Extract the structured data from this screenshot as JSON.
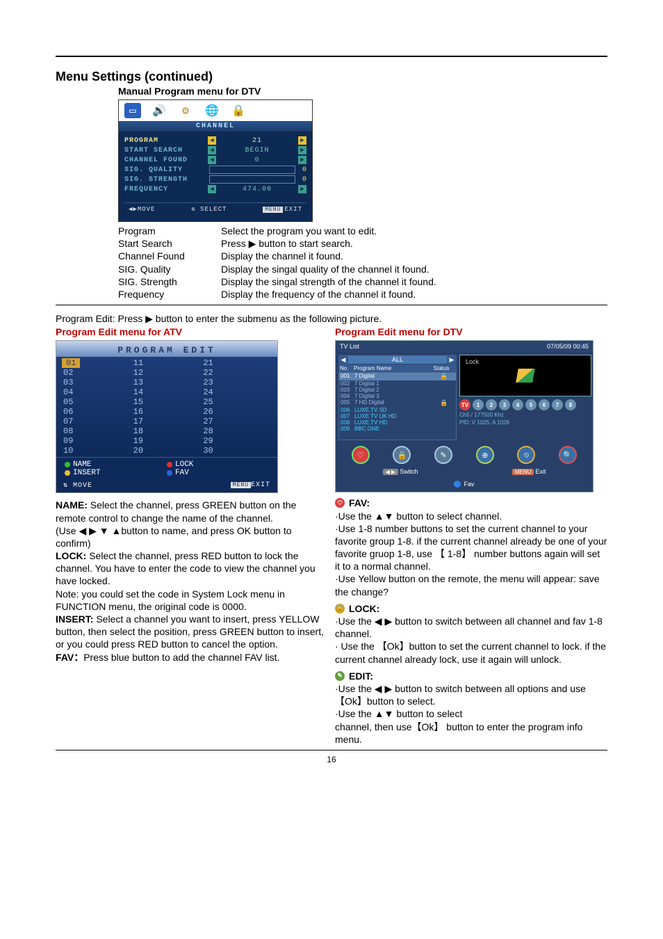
{
  "page_number": "16",
  "heading": "Menu Settings (continued)",
  "subheading_manual": "Manual Program menu for DTV",
  "dtv_menu": {
    "header": "CHANNEL",
    "rows": {
      "program": {
        "label": "PROGRAM",
        "value": "21"
      },
      "start_search": {
        "label": "START SEARCH",
        "value": "BEGIN"
      },
      "channel_found": {
        "label": "CHANNEL FOUND",
        "value": "0"
      },
      "sig_quality": {
        "label": "SIG. QUALITY",
        "value": "0"
      },
      "sig_strength": {
        "label": "SIG. STRENGTH",
        "value": "0"
      },
      "frequency": {
        "label": "FREQUENCY",
        "value": "474.00"
      }
    },
    "footer": {
      "move": "MOVE",
      "select": "SELECT",
      "exit_tag": "MENU",
      "exit": "EXIT"
    }
  },
  "param_labels": {
    "program": "Program",
    "start_search": "Start Search",
    "channel_found": "Channel Found",
    "sig_quality": "SIG. Quality",
    "sig_strength": "SIG. Strength",
    "frequency": "Frequency"
  },
  "param_desc": {
    "program": "Select the program you want to edit.",
    "start_search": "Press ▶ button to start search.",
    "channel_found": "Display the channel it found.",
    "sig_quality": "Display the singal quality of the channel it found.",
    "sig_strength": "Display the singal strength of the channel it found.",
    "frequency": "Display the frequency of the channel it found."
  },
  "program_edit_intro": "Program Edit: Press ▶ button to enter the submenu as the following picture.",
  "atv_header": "Program Edit menu for ATV",
  "dtv_header": "Program Edit menu for DTV",
  "atv_shot": {
    "title": "PROGRAM EDIT",
    "cols": [
      [
        "01",
        "02",
        "03",
        "04",
        "05",
        "06",
        "07",
        "08",
        "09",
        "10"
      ],
      [
        "11",
        "12",
        "13",
        "14",
        "15",
        "16",
        "17",
        "18",
        "19",
        "20"
      ],
      [
        "21",
        "22",
        "23",
        "24",
        "25",
        "26",
        "27",
        "28",
        "29",
        "30"
      ]
    ],
    "legend": {
      "name": "NAME",
      "lock": "LOCK",
      "insert": "INSERT",
      "fav": "FAV"
    },
    "foot": {
      "move": "MOVE",
      "exit_tag": "MENU",
      "exit": "EXIT"
    }
  },
  "dtv_list": {
    "title": "TV List",
    "timestamp": "07/05/09 00:45",
    "tab_label": "ALL",
    "columns": {
      "no": "No.",
      "name": "Program Name",
      "status": "Status"
    },
    "rows": [
      {
        "no": "001",
        "name": "7 Digital",
        "lock": true,
        "hl": true
      },
      {
        "no": "002",
        "name": "7 Digital 1"
      },
      {
        "no": "003",
        "name": "7 Digital 2"
      },
      {
        "no": "004",
        "name": "7 Digital 3"
      },
      {
        "no": "005",
        "name": "7 HD Digital",
        "lock": true
      },
      {
        "no": "006",
        "name": "LUXE.TV SD",
        "blue": true
      },
      {
        "no": "007",
        "name": "LUXE.TV UK HD",
        "blue": true
      },
      {
        "no": "008",
        "name": "LUXE.TV HD",
        "blue": true
      },
      {
        "no": "009",
        "name": "BBC ONE",
        "blue": true
      }
    ],
    "preview_label": "Lock",
    "info1": "Ch5 / 177500 Khz",
    "info2": "PID: V 1025, A 1026",
    "foot": {
      "switch": "Switch",
      "exit": "Exit",
      "exit_tag": "MENU",
      "fav": "Fav",
      "switch_tag": "◀ ▶"
    }
  },
  "left_text": {
    "name_lbl": "NAME:",
    "name_body": " Select the channel, press GREEN button on the remote control to change the name of the channel.",
    "name_note": "(Use ◀ ▶ ▼ ▲button to name, and press OK button to confirm)",
    "lock_lbl": "LOCK:",
    "lock_body": " Select the channel, press RED button to lock the channel. You have to enter the code to view the channel you have locked.",
    "lock_note": "Note: you could set the code in System Lock menu in FUNCTION menu, the original code is 0000.",
    "insert_lbl": "INSERT:",
    "insert_body": " Select a channel you want to insert, press YELLOW button, then select the position, press GREEN button to insert, or you could press RED button to cancel the option.",
    "fav_lbl": "FAV：",
    "fav_body": "Press blue button to add the channel FAV list."
  },
  "right_text": {
    "fav_head": "FAV:",
    "fav_l1": "·Use the ▲▼ button to select channel.",
    "fav_l2": "·Use 1-8 number buttons to set the current channel to your favorite group 1-8. if the current channel already be one of your favorite gruop 1-8, use 【 1-8】 number buttons again will set it to a normal channel.",
    "fav_l3": "·Use Yellow button on the remote, the menu will appear: save the change?",
    "lock_head": "LOCK:",
    "lock_l1": "·Use the ◀ ▶ button to switch between all channel and fav 1-8 channel.",
    "lock_l2": "· Use the 【Ok】button to set the current channel to lock. if the current channel already lock, use it again will unlock.",
    "edit_head": "EDIT:",
    "edit_l1": "·Use the ◀ ▶ button to switch between all options and use【Ok】button to select.",
    "edit_l2": "·Use the ▲▼ button to select",
    "edit_l3": "channel, then use【Ok】 button to enter the program info menu."
  }
}
